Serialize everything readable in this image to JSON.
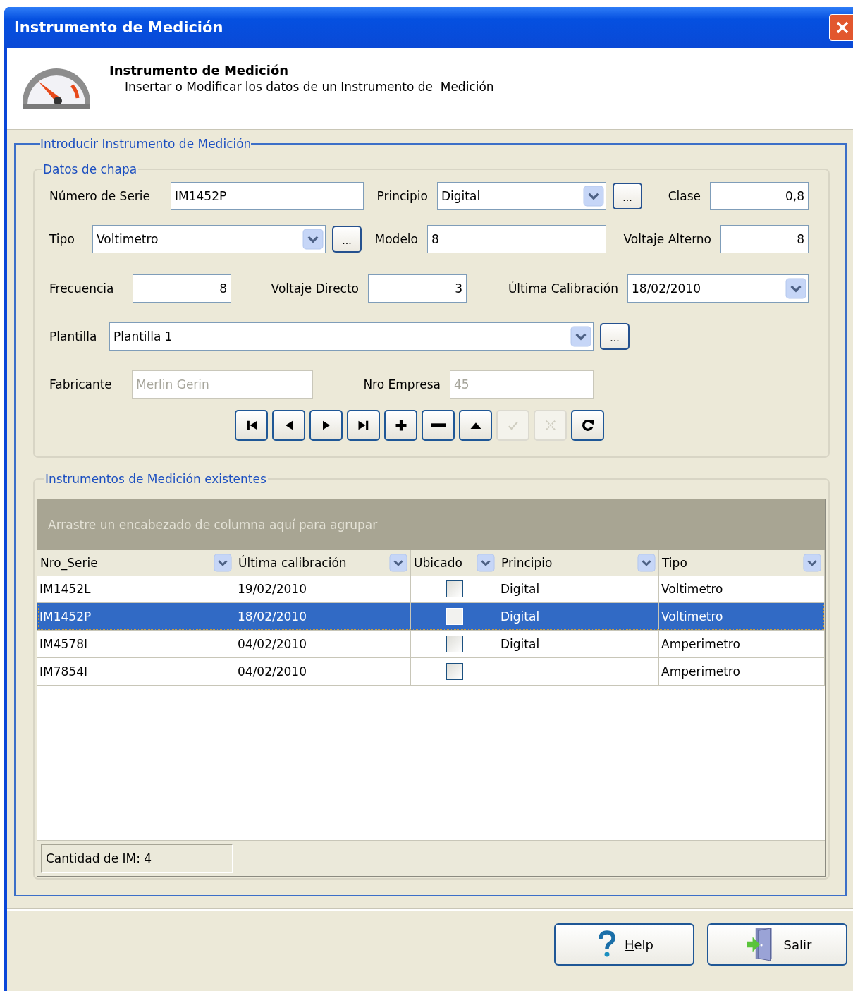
{
  "window": {
    "title": "Instrumento de Medición"
  },
  "header": {
    "title": "Instrumento de Medición",
    "subtitle": "Insertar o Modificar los datos de un Instrumento de  Medición"
  },
  "group": {
    "title": "Introducir Instrumento de Medición"
  },
  "chapa": {
    "title": "Datos de chapa",
    "rows": [
      [
        {
          "kind": "label",
          "text": "Número de Serie"
        },
        {
          "kind": "text",
          "value": "IM1452P",
          "disabled": false
        },
        {
          "kind": "label",
          "text": "Principio"
        },
        {
          "kind": "combo",
          "value": "Digital",
          "disabled": false
        },
        {
          "kind": "ellipsis",
          "text": "..."
        },
        {
          "kind": "label",
          "text": "Clase"
        },
        {
          "kind": "number",
          "value": "0,8",
          "disabled": false
        }
      ],
      [
        {
          "kind": "label",
          "text": "Tipo"
        },
        {
          "kind": "combo",
          "value": "Voltimetro",
          "disabled": false
        },
        {
          "kind": "ellipsis",
          "text": "..."
        },
        {
          "kind": "label",
          "text": "Modelo"
        },
        {
          "kind": "text",
          "value": "8",
          "disabled": false
        },
        {
          "kind": "label",
          "text": "Voltaje Alterno"
        },
        {
          "kind": "number",
          "value": "8",
          "disabled": false
        }
      ],
      [
        {
          "kind": "label",
          "text": "Frecuencia"
        },
        {
          "kind": "number",
          "value": "8",
          "disabled": false
        },
        {
          "kind": "label",
          "text": "Voltaje Directo"
        },
        {
          "kind": "number",
          "value": "3",
          "disabled": false
        },
        {
          "kind": "label",
          "text": "Última Calibración"
        },
        {
          "kind": "combo",
          "value": "18/02/2010",
          "disabled": false
        }
      ],
      [
        {
          "kind": "label",
          "text": "Plantilla"
        },
        {
          "kind": "combo",
          "value": "Plantilla 1",
          "disabled": false
        },
        {
          "kind": "ellipsis",
          "text": "..."
        }
      ],
      [
        {
          "kind": "label",
          "text": "Fabricante"
        },
        {
          "kind": "text",
          "value": "Merlin Gerin",
          "disabled": true
        },
        {
          "kind": "label",
          "text": "Nro Empresa"
        },
        {
          "kind": "text",
          "value": "45",
          "disabled": true
        }
      ]
    ]
  },
  "navigator": [
    {
      "kind": "first",
      "disabled": false
    },
    {
      "kind": "prev",
      "disabled": false
    },
    {
      "kind": "next",
      "disabled": false
    },
    {
      "kind": "last",
      "disabled": false
    },
    {
      "kind": "add",
      "disabled": false
    },
    {
      "kind": "delete",
      "disabled": false
    },
    {
      "kind": "up",
      "disabled": false
    },
    {
      "kind": "confirm",
      "disabled": true
    },
    {
      "kind": "cancel",
      "disabled": true
    },
    {
      "kind": "refresh",
      "disabled": false
    }
  ],
  "list": {
    "title": "Instrumentos de Medición existentes",
    "group_hint": "Arrastre un encabezado de columna aquí para agrupar",
    "columns": [
      "Nro_Serie",
      "Última calibración",
      "Ubicado",
      "Principio",
      "Tipo"
    ],
    "rows": [
      {
        "nro_serie": "IM1452L",
        "calibracion": "19/02/2010",
        "checked": false,
        "principio": "Digital",
        "tipo": "Voltimetro",
        "selected": false
      },
      {
        "nro_serie": "IM1452P",
        "calibracion": "18/02/2010",
        "checked": false,
        "principio": "Digital",
        "tipo": "Voltimetro",
        "selected": true
      },
      {
        "nro_serie": "IM4578I",
        "calibracion": "04/02/2010",
        "checked": false,
        "principio": "Digital",
        "tipo": "Amperimetro",
        "selected": false
      },
      {
        "nro_serie": "IM7854I",
        "calibracion": "04/02/2010",
        "checked": false,
        "tipo": "Amperimetro",
        "selected": false
      }
    ],
    "footer": "Cantidad de IM: 4"
  },
  "buttons": [
    {
      "kind": "help",
      "label": "Help",
      "underline_first": true
    },
    {
      "kind": "exit",
      "label": "Salir",
      "underline_first": false
    }
  ]
}
